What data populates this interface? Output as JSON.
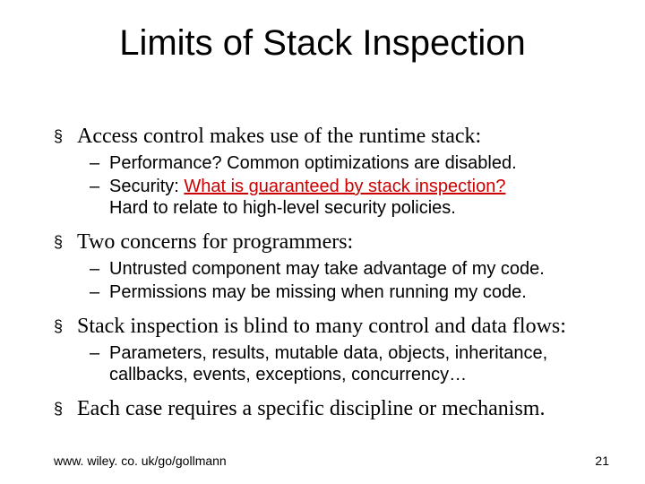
{
  "title": "Limits of Stack Inspection",
  "bullets": {
    "b1": "Access control makes use of the runtime stack:",
    "b1a": "Performance? Common optimizations are disabled.",
    "b1b_pre": "Security: ",
    "b1b_red": "What is guaranteed by stack inspection?",
    "b1b_line2": "Hard to relate to high-level security policies.",
    "b2": "Two concerns for programmers:",
    "b2a": "Untrusted component may take advantage of my code.",
    "b2b": "Permissions may be missing when running my code.",
    "b3": "Stack inspection is blind to many control and data flows:",
    "b3a": "Parameters, results, mutable data, objects, inheritance, callbacks, events, exceptions, concurrency…",
    "b4": "Each case requires a specific discipline or mechanism."
  },
  "markers": {
    "square": "§",
    "dash": "–"
  },
  "footer": {
    "url": "www. wiley. co. uk/go/gollmann",
    "page": "21"
  }
}
